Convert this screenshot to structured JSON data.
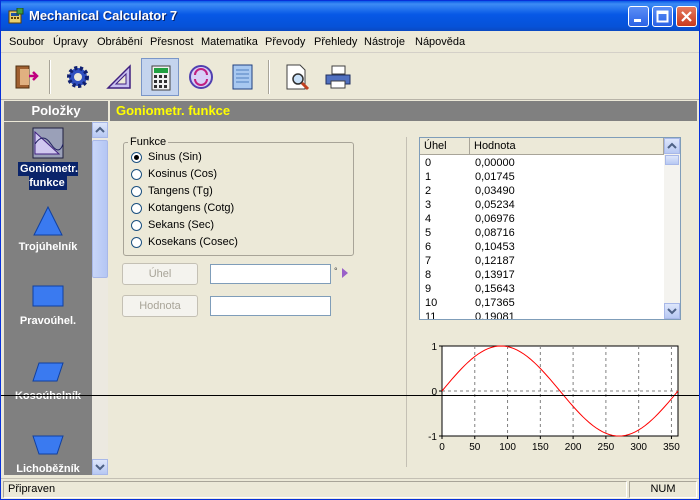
{
  "window": {
    "title": "Mechanical Calculator 7"
  },
  "menu": [
    "Soubor",
    "Úpravy",
    "Obrábění",
    "Přesnost",
    "Matematika",
    "Převody",
    "Přehledy",
    "Nástroje",
    "Nápověda"
  ],
  "toolbar": [
    "exit-icon",
    "settings-gear-icon",
    "triangle-ruler-icon",
    "calculator-icon",
    "convert-icon",
    "notebook-icon",
    "print-preview-icon",
    "print-icon"
  ],
  "left_panel": {
    "header": "Položky",
    "items": [
      {
        "label": "Goniometr. funkce",
        "icon": "goniometric-icon",
        "selected": true
      },
      {
        "label": "Trojúhelník",
        "icon": "triangle-icon"
      },
      {
        "label": "Pravoúhel.",
        "icon": "rectangle-icon"
      },
      {
        "label": "Kosoúhelník",
        "icon": "parallelogram-icon"
      },
      {
        "label": "Lichoběžník",
        "icon": "trapezoid-icon"
      }
    ]
  },
  "content": {
    "header": "Goniometr. funkce",
    "function_group": {
      "legend": "Funkce",
      "options": [
        "Sinus (Sin)",
        "Kosinus (Cos)",
        "Tangens (Tg)",
        "Kotangens (Cotg)",
        "Sekans (Sec)",
        "Kosekans (Cosec)"
      ],
      "selected": 0
    },
    "angle_button": "Úhel",
    "value_button": "Hodnota",
    "angle_unit": "°",
    "angle_value": "",
    "value_value": ""
  },
  "table": {
    "columns": [
      "Úhel",
      "Hodnota"
    ],
    "rows": [
      [
        "0",
        "0,00000"
      ],
      [
        "1",
        "0,01745"
      ],
      [
        "2",
        "0,03490"
      ],
      [
        "3",
        "0,05234"
      ],
      [
        "4",
        "0,06976"
      ],
      [
        "5",
        "0,08716"
      ],
      [
        "6",
        "0,10453"
      ],
      [
        "7",
        "0,12187"
      ],
      [
        "8",
        "0,13917"
      ],
      [
        "9",
        "0,15643"
      ],
      [
        "10",
        "0,17365"
      ],
      [
        "11",
        "0,19081"
      ]
    ]
  },
  "chart_data": {
    "type": "line",
    "function": "sin",
    "xlim": [
      0,
      360
    ],
    "ylim": [
      -1,
      1
    ],
    "x_ticks": [
      0,
      50,
      100,
      150,
      200,
      250,
      300,
      350
    ],
    "y_ticks": [
      1,
      0,
      -1
    ],
    "x_grid": [
      50,
      100,
      150,
      200,
      250,
      300,
      350
    ],
    "series": [
      {
        "color": "#ff0000",
        "x_step": 5
      }
    ]
  },
  "status": {
    "text": "Připraven",
    "num": "NUM"
  }
}
